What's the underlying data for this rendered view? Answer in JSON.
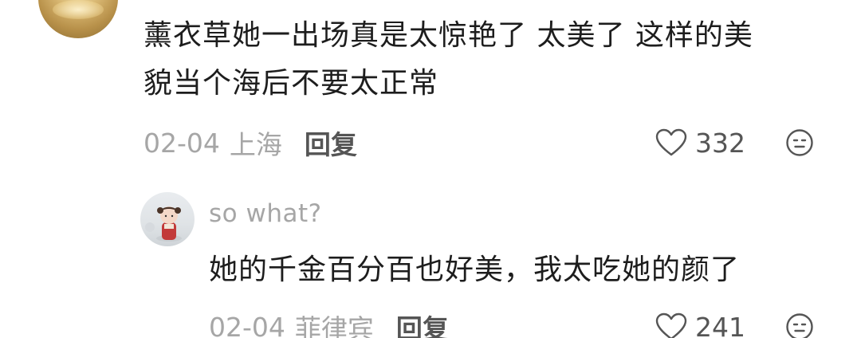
{
  "comment": {
    "text_line1": "薰衣草她一出场真是太惊艳了 太美了 这样的美",
    "text_line2": "貌当个海后不要太正常",
    "date": "02-04",
    "location": "上海",
    "reply_label": "回复",
    "likes": "332"
  },
  "reply": {
    "username": "so what?",
    "text": "她的千金百分百也好美，我太吃她的颜了",
    "date": "02-04",
    "location": "菲律宾",
    "reply_label": "回复",
    "likes": "241"
  },
  "colors": {
    "text_primary": "#1d1d1d",
    "text_secondary": "#a6a6a6",
    "text_action": "#555555",
    "background": "#ffffff"
  },
  "icons": {
    "like": "heart-outline-icon",
    "dislike": "neutral-face-icon"
  }
}
